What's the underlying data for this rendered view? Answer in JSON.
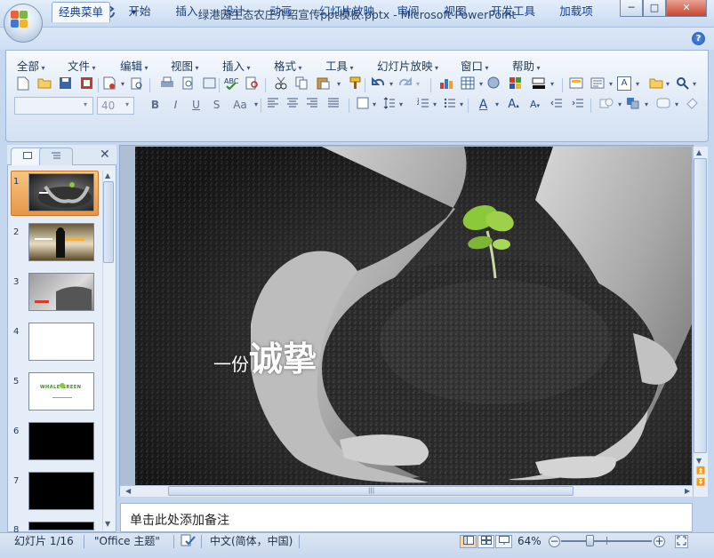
{
  "window": {
    "title": "绿港园生态农庄介绍宣传ppt模板.pptx - Microsoft PowerPoint",
    "minimize": "─",
    "maximize": "□",
    "close": "✕"
  },
  "quick_access": {
    "save_icon": "save-icon",
    "undo_icon": "undo-icon",
    "redo_icon": "redo-icon"
  },
  "ribbon_tabs": [
    "经典菜单",
    "开始",
    "插入",
    "设计",
    "动画",
    "幻灯片放映",
    "审阅",
    "视图",
    "开发工具",
    "加载项"
  ],
  "classic_menus": [
    "全部",
    "文件",
    "编辑",
    "视图",
    "插入",
    "格式",
    "工具",
    "幻灯片放映",
    "窗口",
    "帮助"
  ],
  "font": {
    "name": "",
    "size": "40"
  },
  "format_buttons": {
    "bold": "B",
    "italic": "I",
    "underline": "U",
    "strike": "S",
    "case": "Aa"
  },
  "slides_panel": {
    "thumb_numbers": [
      "1",
      "2",
      "3",
      "4",
      "5",
      "6",
      "7",
      "8"
    ],
    "thumb5_logo": "WHALE GREEN",
    "close": "✕"
  },
  "slide": {
    "text_small": "一份",
    "text_big": "诚挚"
  },
  "notes": {
    "placeholder": "单击此处添加备注"
  },
  "status": {
    "slide_counter": "幻灯片 1/16",
    "theme": "\"Office 主题\"",
    "language": "中文(简体，中国)",
    "zoom": "64%"
  },
  "colors": {
    "ribbon_bg": "#dfe9f6",
    "selected_thumb": "#f0b060",
    "sprout": "#8bc83a"
  }
}
